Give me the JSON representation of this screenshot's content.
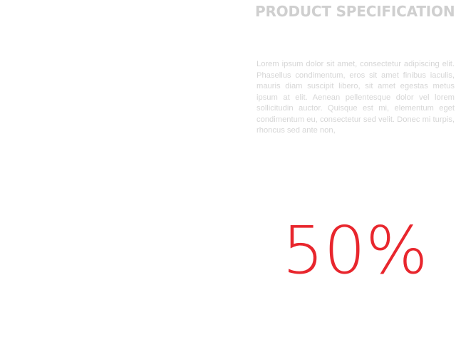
{
  "section": {
    "title": "PRODUCT SPECIFICATION",
    "body": "Lorem ipsum dolor sit amet, consectetur adipisc­ing elit. Phasellus condimentum, eros sit amet fin­ibus iaculis, mauris diam suscipit libero, sit amet egestas metus ipsum at elit. Aenean pellentesque dolor vel lorem sollicitudin auctor. Quisque est mi, elementum eget condimentum eu, consectetur sed velit. Donec mi turpis, rhoncus sed ante non,",
    "stat": "50%"
  },
  "colors": {
    "title": "#cfcfcf",
    "body": "#d6d6d6",
    "accent": "#e8262d"
  }
}
